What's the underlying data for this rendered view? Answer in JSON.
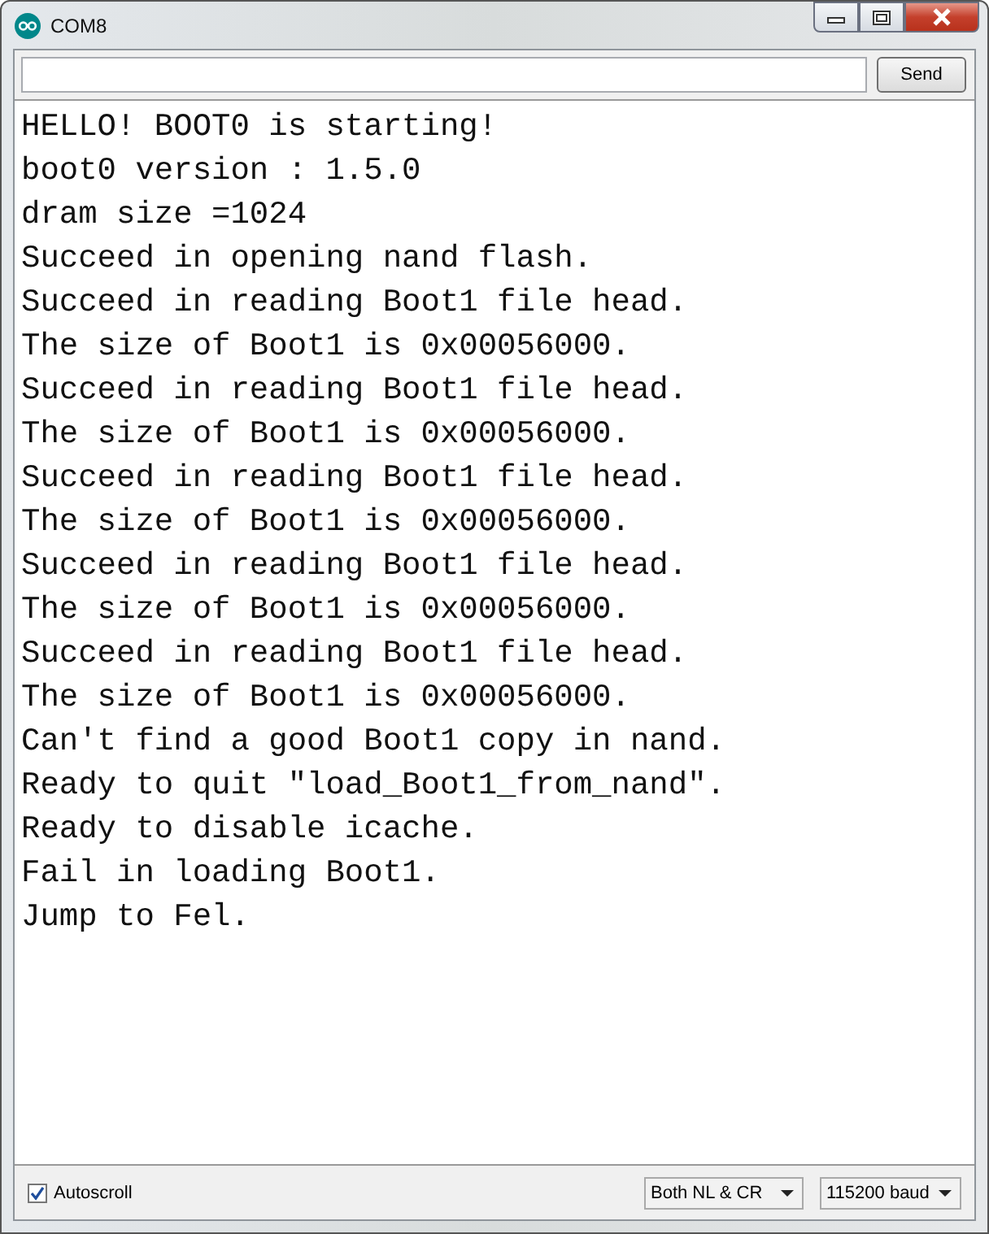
{
  "window": {
    "title": "COM8"
  },
  "send_button": "Send",
  "output_lines": [
    "HELLO! BOOT0 is starting!",
    "boot0 version : 1.5.0",
    "dram size =1024",
    "Succeed in opening nand flash.",
    "Succeed in reading Boot1 file head.",
    "The size of Boot1 is 0x00056000.",
    "Succeed in reading Boot1 file head.",
    "The size of Boot1 is 0x00056000.",
    "Succeed in reading Boot1 file head.",
    "The size of Boot1 is 0x00056000.",
    "Succeed in reading Boot1 file head.",
    "The size of Boot1 is 0x00056000.",
    "Succeed in reading Boot1 file head.",
    "The size of Boot1 is 0x00056000.",
    "Can't find a good Boot1 copy in nand.",
    "Ready to quit \"load_Boot1_from_nand\".",
    "Ready to disable icache.",
    "Fail in loading Boot1.",
    "Jump to Fel."
  ],
  "autoscroll": {
    "label": "Autoscroll",
    "checked": true
  },
  "line_ending": "Both NL & CR",
  "baud": "115200 baud"
}
